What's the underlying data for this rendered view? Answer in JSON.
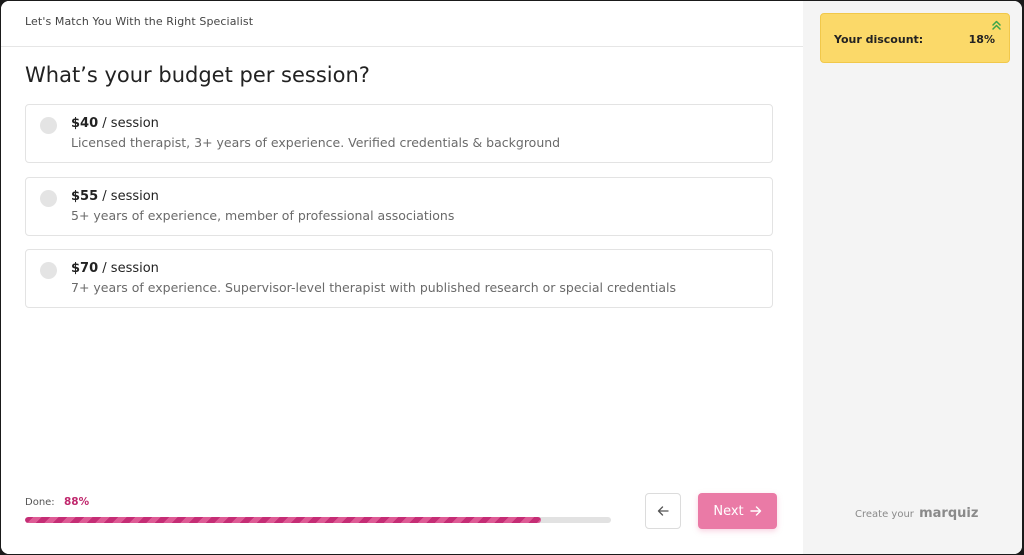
{
  "header": {
    "title": "Let's Match You With the Right Specialist"
  },
  "question": {
    "text": "What’s your budget per session?"
  },
  "options": [
    {
      "price": "$40",
      "unit": "/ session",
      "description": "Licensed therapist, 3+ years of experience. Verified credentials & background"
    },
    {
      "price": "$55",
      "unit": "/ session",
      "description": "5+ years of experience, member of professional associations"
    },
    {
      "price": "$70",
      "unit": "/ session",
      "description": "7+ years of experience. Supervisor-level therapist with published research or special credentials"
    }
  ],
  "progress": {
    "label": "Done:",
    "value_text": "88%",
    "percent": 88
  },
  "nav": {
    "next_label": "Next"
  },
  "discount": {
    "label": "Your discount:",
    "value": "18%"
  },
  "brand": {
    "prefix": "Create your",
    "name": "marquiz"
  },
  "colors": {
    "accent": "#c52d75",
    "next_button": "#ea7aa6",
    "discount_bg": "#fbd969",
    "discount_icon": "#3aa64a"
  }
}
